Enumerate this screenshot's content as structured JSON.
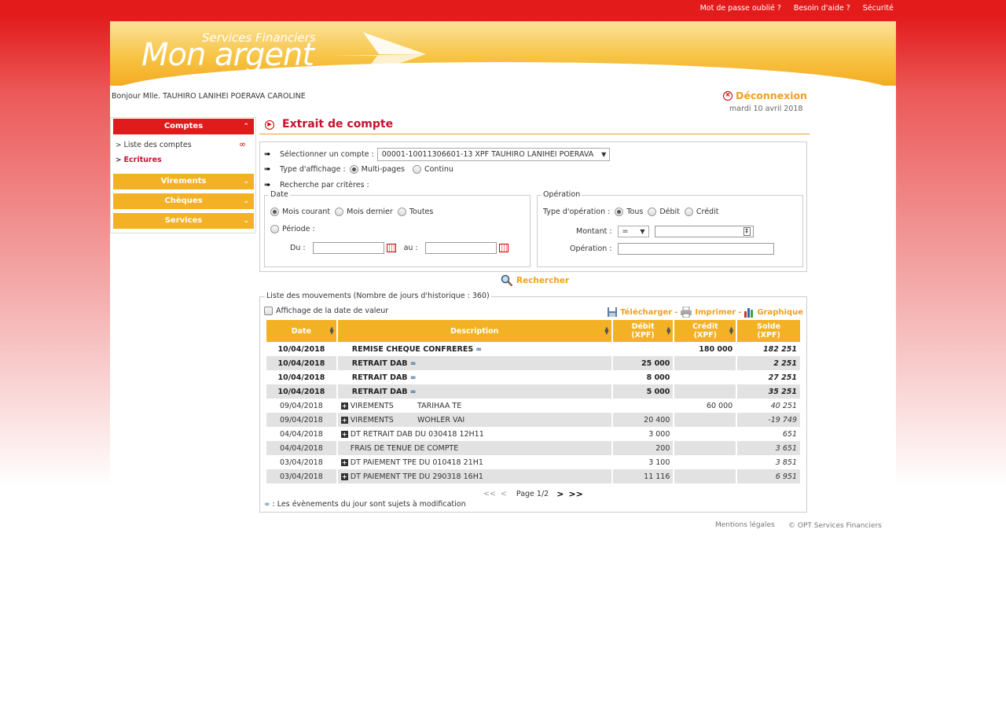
{
  "top_links": [
    "Mot de passe oublié ?",
    "Besoin d'aide ?",
    "Sécurité"
  ],
  "logo": {
    "sub": "Services Financiers",
    "main": "Mon argent"
  },
  "greeting": "Bonjour Mlle. TAUHIRO LANIHEI POERAVA CAROLINE",
  "logout_label": "Déconnexion",
  "date": "mardi 10 avril 2018",
  "sidebar": {
    "comptes_label": "Comptes",
    "items": [
      "Liste des comptes",
      "Ecritures"
    ],
    "virements_label": "Virements",
    "cheques_label": "Chèques",
    "services_label": "Services"
  },
  "page_title": "Extrait de compte",
  "criteria": {
    "select_account_label": "Sélectionner un compte :",
    "account_value": "00001-10011306601-13 XPF TAUHIRO LANIHEI POERAVA",
    "display_type_label": "Type d'affichage :",
    "display_multi": "Multi-pages",
    "display_continu": "Continu",
    "search_by_criteria": "Recherche par critères :",
    "date_legend": "Date",
    "date_current_month": "Mois courant",
    "date_last_month": "Mois dernier",
    "date_all": "Toutes",
    "date_period": "Période :",
    "from_label": "Du :",
    "to_label": "au :",
    "operation_legend": "Opération",
    "op_type_label": "Type d'opération :",
    "op_all": "Tous",
    "op_debit": "Débit",
    "op_credit": "Crédit",
    "amount_label": "Montant :",
    "amount_operator": "=",
    "operation_label": "Opération :"
  },
  "search_label": "Rechercher",
  "movements": {
    "legend": "Liste des mouvements (Nombre de jours d'historique : 360)",
    "value_date_label": "Affichage de la date de valeur",
    "download_label": "Télécharger",
    "print_label": "Imprimer",
    "graph_label": "Graphique",
    "separator": "-",
    "headers": {
      "date": "Date",
      "description": "Description",
      "debit": "Débit",
      "credit": "Crédit",
      "balance": "Solde",
      "currency": "(XPF)"
    },
    "rows": [
      {
        "date": "10/04/2018",
        "desc": "REMISE CHEQUE CONFRERES",
        "debit": "",
        "credit": "180 000",
        "balance": "182 251"
      },
      {
        "date": "10/04/2018",
        "desc": "RETRAIT DAB",
        "debit": "25 000",
        "credit": "",
        "balance": "2 251"
      },
      {
        "date": "10/04/2018",
        "desc": "RETRAIT DAB",
        "debit": "8 000",
        "credit": "",
        "balance": "27 251"
      },
      {
        "date": "10/04/2018",
        "desc": "RETRAIT DAB",
        "debit": "5 000",
        "credit": "",
        "balance": "35 251"
      },
      {
        "date": "09/04/2018",
        "desc": "VIREMENTS          TARIHAA TE",
        "debit": "",
        "credit": "60 000",
        "balance": "40 251"
      },
      {
        "date": "09/04/2018",
        "desc": "VIREMENTS          WOHLER VAI",
        "debit": "20 400",
        "credit": "",
        "balance": "-19 749"
      },
      {
        "date": "04/04/2018",
        "desc": "DT RETRAIT DAB DU 030418 12H11",
        "debit": "3 000",
        "credit": "",
        "balance": "651"
      },
      {
        "date": "04/04/2018",
        "desc": "FRAIS DE TENUE DE COMPTE",
        "debit": "200",
        "credit": "",
        "balance": "3 651"
      },
      {
        "date": "03/04/2018",
        "desc": "DT PAIEMENT TPE DU 010418 21H1",
        "debit": "3 100",
        "credit": "",
        "balance": "3 851"
      },
      {
        "date": "03/04/2018",
        "desc": "DT PAIEMENT TPE DU 290318 16H1",
        "debit": "11 116",
        "credit": "",
        "balance": "6 951"
      }
    ],
    "pager": {
      "first": "<<",
      "prev": "<",
      "page": "Page 1/2",
      "next": ">",
      "last": ">>"
    },
    "note": ": Les évènements du jour sont sujets à modification"
  },
  "footer": {
    "legal": "Mentions légales",
    "copyright": "© OPT Services Financiers"
  },
  "colors": {
    "brand_red": "#e01b1b",
    "brand_orange": "#f3b225",
    "title_red": "#c8102e",
    "link_orange": "#f0a020"
  }
}
